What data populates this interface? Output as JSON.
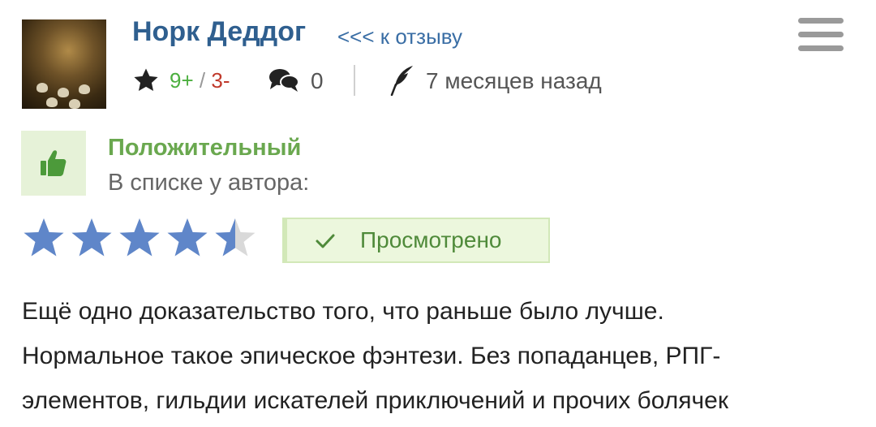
{
  "header": {
    "username": "Норк Деддог",
    "back_link": "<<< к отзыву"
  },
  "meta": {
    "votes_plus": "9+",
    "votes_separator": "/",
    "votes_minus": "3-",
    "comments_count": "0",
    "time_ago": "7 месяцев назад"
  },
  "review": {
    "rating_type": "Положительный",
    "in_author_list": "В списке у автора:",
    "stars": {
      "rating": 4.5,
      "max": 5
    },
    "viewed_label": "Просмотрено",
    "text_lines": [
      "Ещё одно доказательство того, что раньше было лучше.",
      "Нормальное такое эпическое фэнтези. Без попаданцев, РПГ-",
      "элементов, гильдии искателей приключений и прочих болячек"
    ]
  },
  "colors": {
    "username": "#2f5f8f",
    "positive_green": "#6aa84f",
    "star_blue": "#5f86c9",
    "star_empty": "#d9d9d9",
    "badge_bg": "#ecf7dd"
  },
  "icons": {
    "menu": "hamburger-menu-icon",
    "vote": "star-icon",
    "comments": "comments-icon",
    "written": "quill-icon",
    "positive": "thumbs-up-icon",
    "viewed": "checkmark-icon"
  }
}
